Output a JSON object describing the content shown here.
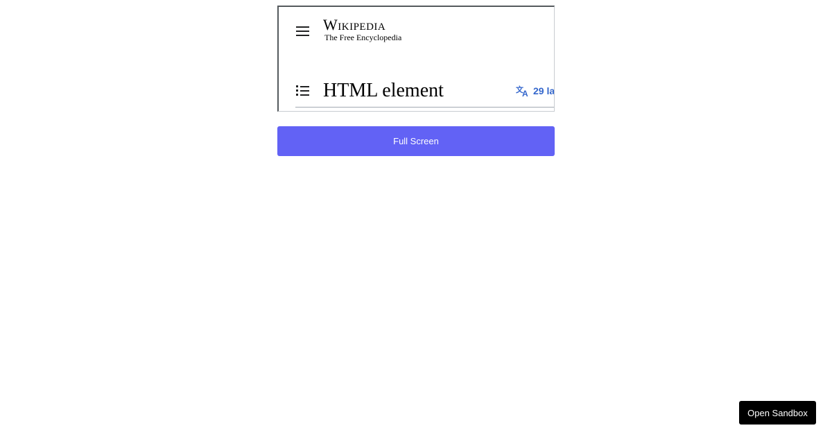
{
  "embed": {
    "logo": {
      "wordmark": "Wikipedia",
      "tagline": "The Free Encyclopedia"
    },
    "menu_icon": "hamburger-menu-icon",
    "toc_icon": "table-of-contents-icon",
    "page_title": "HTML element",
    "language_button": {
      "icon": "translate-icon",
      "label": "29 la",
      "color": "#3366cc"
    }
  },
  "fullscreen_button": {
    "label": "Full Screen",
    "color": "#6262f5"
  },
  "sandbox_button": {
    "label": "Open Sandbox",
    "color": "#000000"
  }
}
